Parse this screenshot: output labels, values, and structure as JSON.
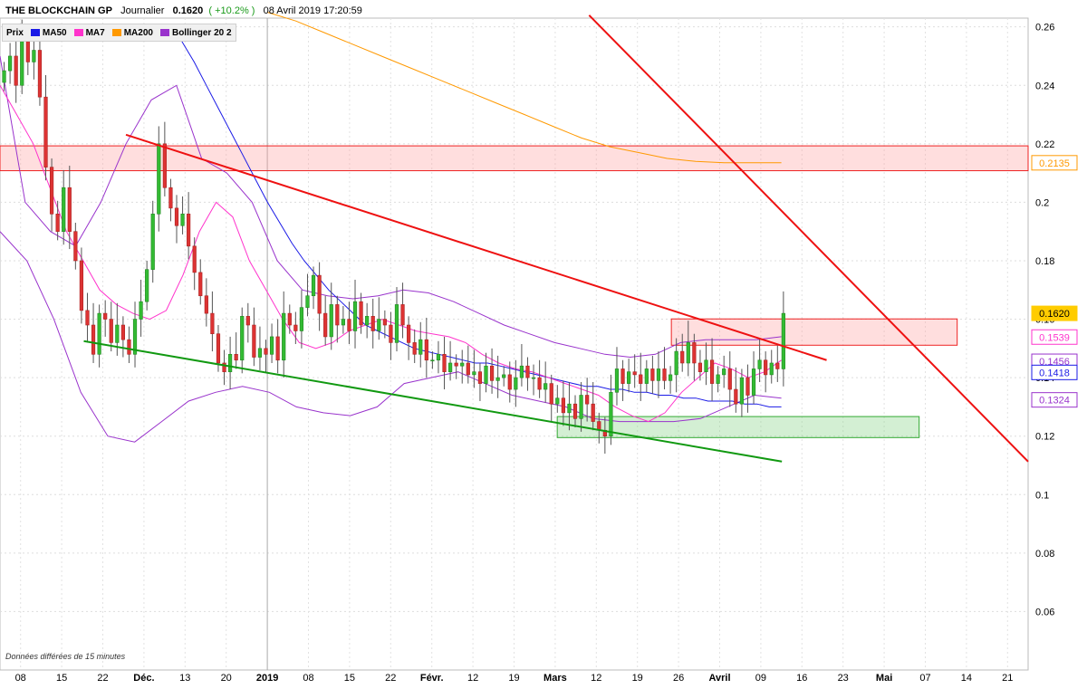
{
  "header": {
    "name": "THE BLOCKCHAIN GP",
    "period": "Journalier",
    "price": "0.1620",
    "change": "( +10.2% )",
    "datetime": "08 Avril 2019 17:20:59"
  },
  "legend": [
    {
      "label": "Prix",
      "color": ""
    },
    {
      "label": "MA50",
      "color": "#1a1ae6"
    },
    {
      "label": "MA7",
      "color": "#ff33cc"
    },
    {
      "label": "MA200",
      "color": "#ff9900"
    },
    {
      "label": "Bollinger 20 2",
      "color": "#9933cc"
    }
  ],
  "note": "Données différées de 15 minutes",
  "chart_data": {
    "type": "candlestick",
    "ylim": [
      0.04,
      0.263
    ],
    "y_ticks": [
      "0.26",
      "0.24",
      "0.22",
      "0.2",
      "0.18",
      "0.16",
      "0.14",
      "0.12",
      "0.1",
      "0.08",
      "0.06"
    ],
    "x_ticks": [
      "08",
      "15",
      "22",
      "Déc.",
      "13",
      "20",
      "2019",
      "08",
      "15",
      "22",
      "Févr.",
      "12",
      "19",
      "Mars",
      "12",
      "19",
      "26",
      "Avril",
      "09",
      "16",
      "23",
      "Mai",
      "07",
      "14",
      "21"
    ],
    "price_labels": [
      {
        "value": 0.162,
        "text": "0.1620",
        "color": "#ffcc00"
      },
      {
        "value": 0.2135,
        "text": "0.2135",
        "color": "#ff9900"
      },
      {
        "value": 0.1539,
        "text": "0.1539",
        "color": "#ff33cc"
      },
      {
        "value": 0.1456,
        "text": "0.1456",
        "color": "#9933cc"
      },
      {
        "value": 0.1418,
        "text": "0.1418",
        "color": "#1a1ae6"
      },
      {
        "value": 0.1324,
        "text": "0.1324",
        "color": "#9933cc"
      }
    ],
    "candles_close": [
      0.245,
      0.25,
      0.24,
      0.255,
      0.248,
      0.252,
      0.236,
      0.212,
      0.196,
      0.19,
      0.205,
      0.19,
      0.18,
      0.163,
      0.158,
      0.148,
      0.162,
      0.16,
      0.152,
      0.158,
      0.153,
      0.148,
      0.16,
      0.166,
      0.177,
      0.196,
      0.22,
      0.205,
      0.198,
      0.192,
      0.196,
      0.185,
      0.176,
      0.168,
      0.162,
      0.155,
      0.145,
      0.142,
      0.148,
      0.146,
      0.161,
      0.158,
      0.147,
      0.15,
      0.148,
      0.154,
      0.146,
      0.162,
      0.158,
      0.156,
      0.164,
      0.168,
      0.175,
      0.162,
      0.154,
      0.165,
      0.158,
      0.16,
      0.156,
      0.166,
      0.158,
      0.161,
      0.156,
      0.16,
      0.158,
      0.152,
      0.165,
      0.158,
      0.152,
      0.148,
      0.153,
      0.146,
      0.146,
      0.148,
      0.142,
      0.145,
      0.144,
      0.145,
      0.141,
      0.142,
      0.138,
      0.144,
      0.139,
      0.14,
      0.141,
      0.136,
      0.14,
      0.144,
      0.14,
      0.14,
      0.136,
      0.138,
      0.131,
      0.133,
      0.128,
      0.131,
      0.126,
      0.134,
      0.131,
      0.125,
      0.122,
      0.12,
      0.135,
      0.143,
      0.138,
      0.142,
      0.141,
      0.138,
      0.143,
      0.139,
      0.143,
      0.139,
      0.141,
      0.149,
      0.145,
      0.152,
      0.145,
      0.142,
      0.146,
      0.138,
      0.141,
      0.143,
      0.136,
      0.131,
      0.14,
      0.134,
      0.143,
      0.146,
      0.141,
      0.145,
      0.143,
      0.162
    ],
    "ma50": [
      0.26,
      0.255,
      0.248,
      0.24,
      0.232,
      0.224,
      0.216,
      0.208,
      0.2,
      0.193,
      0.186,
      0.18,
      0.175,
      0.17,
      0.166,
      0.162,
      0.158,
      0.156,
      0.154,
      0.152,
      0.15,
      0.149,
      0.148,
      0.147,
      0.146,
      0.145,
      0.145,
      0.144,
      0.143,
      0.142,
      0.141,
      0.14,
      0.139,
      0.138,
      0.137,
      0.137,
      0.136,
      0.136,
      0.135,
      0.135,
      0.134,
      0.134,
      0.133,
      0.133,
      0.132,
      0.132,
      0.132,
      0.131,
      0.131,
      0.13,
      0.13
    ],
    "ma200": [
      0.265,
      0.262,
      0.258,
      0.254,
      0.25,
      0.246,
      0.242,
      0.238,
      0.234,
      0.23,
      0.226,
      0.222,
      0.219,
      0.217,
      0.215,
      0.214,
      0.2135,
      0.2135,
      0.2135
    ],
    "ma7": [
      0.24,
      0.23,
      0.22,
      0.205,
      0.19,
      0.18,
      0.17,
      0.165,
      0.162,
      0.16,
      0.163,
      0.175,
      0.19,
      0.2,
      0.195,
      0.18,
      0.17,
      0.16,
      0.152,
      0.15,
      0.152,
      0.156,
      0.158,
      0.16,
      0.158,
      0.156,
      0.155,
      0.154,
      0.152,
      0.148,
      0.145,
      0.143,
      0.142,
      0.14,
      0.138,
      0.136,
      0.134,
      0.13,
      0.127,
      0.125,
      0.128,
      0.135,
      0.14,
      0.145,
      0.143,
      0.14,
      0.142,
      0.146
    ],
    "bb_upper": [
      0.25,
      0.2,
      0.19,
      0.185,
      0.2,
      0.22,
      0.235,
      0.24,
      0.215,
      0.21,
      0.2,
      0.18,
      0.17,
      0.168,
      0.167,
      0.168,
      0.17,
      0.169,
      0.166,
      0.162,
      0.158,
      0.155,
      0.152,
      0.15,
      0.148,
      0.147,
      0.148,
      0.152,
      0.153,
      0.153,
      0.153,
      0.154
    ],
    "bb_lower": [
      0.19,
      0.18,
      0.16,
      0.135,
      0.12,
      0.118,
      0.125,
      0.132,
      0.135,
      0.137,
      0.135,
      0.13,
      0.128,
      0.127,
      0.13,
      0.138,
      0.14,
      0.142,
      0.138,
      0.134,
      0.132,
      0.13,
      0.126,
      0.125,
      0.125,
      0.125,
      0.126,
      0.13,
      0.134,
      0.133
    ],
    "trendlines": [
      {
        "color": "#ee1111",
        "from": [
          0.2231,
          0.2111
        ],
        "to": [
          0.146,
          0.062
        ]
      },
      {
        "color": "#ee1111",
        "from": [
          0.264,
          0.1667
        ],
        "to": [
          0.1655,
          0.0962
        ]
      },
      {
        "color": "#119911",
        "from": [
          0.1525,
          0.0766
        ],
        "to": [
          0.1113,
          0.0722
        ]
      }
    ],
    "zones": [
      {
        "kind": "resistance",
        "ymin": 0.2108,
        "ymax": 0.2193
      },
      {
        "kind": "resistance",
        "ymin": 0.1511,
        "ymax": 0.1601
      },
      {
        "kind": "support",
        "ymin": 0.1195,
        "ymax": 0.1267
      }
    ]
  }
}
